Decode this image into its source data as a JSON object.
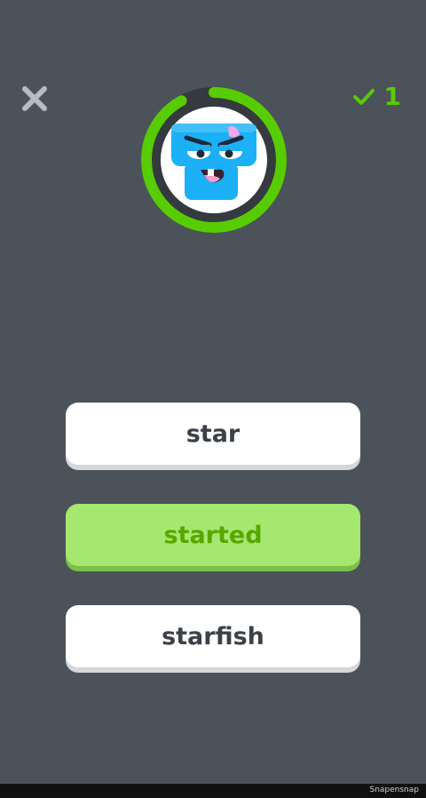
{
  "header": {
    "close_icon": "close-icon",
    "score_icon": "checkmark-icon",
    "score_count": "1"
  },
  "timer": {
    "progress": 0.92,
    "ring_color": "#58cc02",
    "avatar_icon": "robot-character-icon"
  },
  "options": [
    {
      "label": "star",
      "state": "default"
    },
    {
      "label": "started",
      "state": "selected"
    },
    {
      "label": "starfish",
      "state": "default"
    }
  ],
  "colors": {
    "background": "#4b525a",
    "accent_green": "#58cc02",
    "selected_fill": "#a5e76f",
    "selected_text": "#58a700",
    "option_text": "#3c4148"
  },
  "footer": {
    "watermark": "Snapensnap"
  }
}
